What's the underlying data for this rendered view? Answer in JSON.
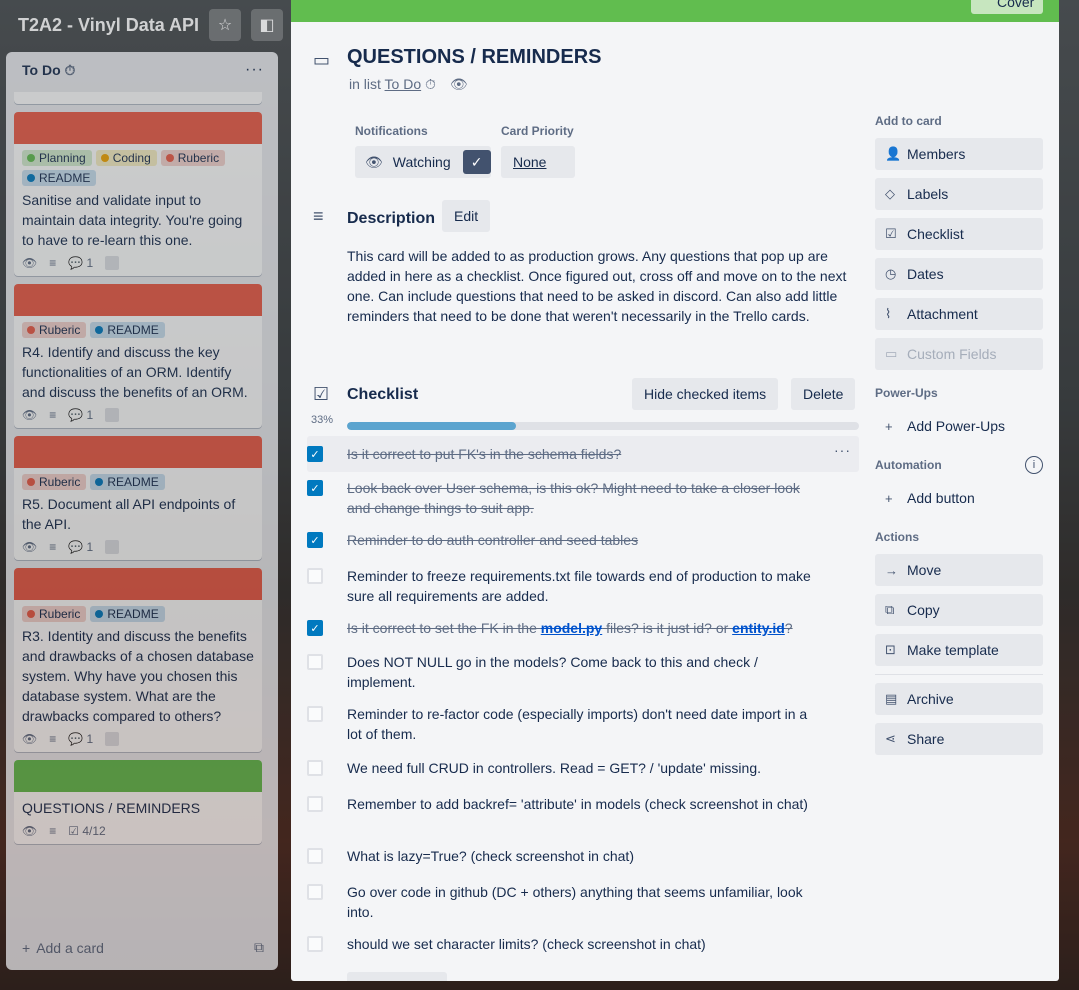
{
  "board": {
    "title": "T2A2 - Vinyl Data API",
    "star_icon": "star-icon",
    "colors": {
      "cover_green": "#61bd4f",
      "cover_red": "#eb5a46",
      "checkbox_blue": "#0079bf",
      "progress": "#5ba4cf"
    }
  },
  "list": {
    "title": "To Do",
    "menu_label": "···",
    "add_card_label": "Add a card",
    "cards": [
      {
        "labels": [
          {
            "text": "Planning",
            "color": "#61bd4f"
          },
          {
            "text": "Coding",
            "color": "#f2d600"
          },
          {
            "text": "Ruberic",
            "color": "#eb5a46"
          },
          {
            "text": "README",
            "color": "#0079bf"
          }
        ],
        "text": "Sanitise and validate input to maintain data integrity. You're going to have to re-learn this one.",
        "comments": "1"
      },
      {
        "labels": [
          {
            "text": "Ruberic",
            "color": "#eb5a46"
          },
          {
            "text": "README",
            "color": "#0079bf"
          }
        ],
        "text": "R4. Identify and discuss the key functionalities of an ORM. Identify and discuss the benefits of an ORM.",
        "comments": "1"
      },
      {
        "labels": [
          {
            "text": "Ruberic",
            "color": "#eb5a46"
          },
          {
            "text": "README",
            "color": "#0079bf"
          }
        ],
        "text": "R5. Document all API endpoints of the API.",
        "comments": "1"
      },
      {
        "labels": [
          {
            "text": "Ruberic",
            "color": "#eb5a46"
          },
          {
            "text": "README",
            "color": "#0079bf"
          }
        ],
        "text": "R3. Identity and discuss the benefits and drawbacks of a chosen database system. Why have you chosen this database system. What are the drawbacks compared to others?",
        "comments": "1"
      },
      {
        "labels": [],
        "text": "QUESTIONS / REMINDERS",
        "checklist_badge": "4/12"
      }
    ]
  },
  "modal": {
    "cover_button": "Cover",
    "title": "QUESTIONS / REMINDERS",
    "in_list_prefix": "in list",
    "in_list_name": "To Do",
    "notifications_label": "Notifications",
    "watching_label": "Watching",
    "card_priority_label": "Card Priority",
    "card_priority_value": "None",
    "description_title": "Description",
    "edit_label": "Edit",
    "description": "This card will be added to as production grows. Any questions that pop up are added in here as a checklist. Once figured out, cross off and move on to the next one. Can include questions that need to be asked in discord. Can also add little reminders that need to be done that weren't necessarily in the Trello cards.",
    "checklist_title": "Checklist",
    "hide_checked_label": "Hide checked items",
    "delete_label": "Delete",
    "progress_text": "33%",
    "progress_value": 0.33,
    "checklist": [
      {
        "text": "Is it correct to put FK's in the schema fields?",
        "checked": true
      },
      {
        "text": "Look back over User schema, is this ok? Might need to take a closer look and change things to suit app.",
        "checked": true
      },
      {
        "text": "Reminder to do auth controller and seed tables",
        "checked": true
      },
      {
        "text": "Reminder to freeze requirements.txt file towards end of production to make sure all requirements are added.",
        "checked": false
      },
      {
        "text_pre": "Is it correct to set the FK in the ",
        "link1": "model.py",
        "text_mid": " files? is it just id? or ",
        "link2": "entity.id",
        "text_post": "?",
        "checked": true
      },
      {
        "text": "Does NOT NULL go in the models? Come back to this and check / implement.",
        "checked": false
      },
      {
        "text": "Reminder to re-factor code (especially imports) don't need date import in a lot of them.",
        "checked": false
      },
      {
        "text": "We need full CRUD in controllers. Read = GET? / 'update' missing.",
        "checked": false
      },
      {
        "text": "Remember to add backref= 'attribute' in models (check screenshot in chat)",
        "checked": false
      },
      {
        "text": "What is lazy=True? (check screenshot in chat)",
        "checked": false
      },
      {
        "text": "Go over code in github (DC + others) anything that seems unfamiliar, look into.",
        "checked": false
      },
      {
        "text": "should we set character limits? (check screenshot in chat)",
        "checked": false
      }
    ],
    "sidebar": {
      "add_to_card": "Add to card",
      "members": "Members",
      "labels": "Labels",
      "checklist": "Checklist",
      "dates": "Dates",
      "attachment": "Attachment",
      "custom_fields": "Custom Fields",
      "power_ups_head": "Power-Ups",
      "add_power_ups": "Add Power-Ups",
      "automation_head": "Automation",
      "add_button": "Add button",
      "actions_head": "Actions",
      "move": "Move",
      "copy": "Copy",
      "make_template": "Make template",
      "archive": "Archive",
      "share": "Share"
    }
  }
}
